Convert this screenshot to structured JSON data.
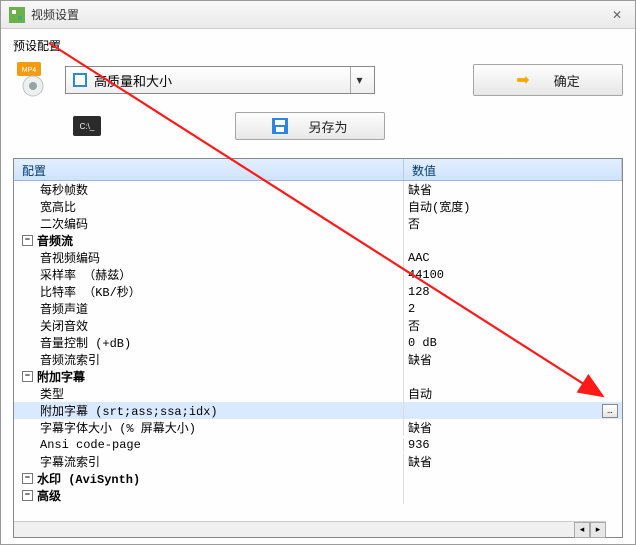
{
  "window": {
    "title": "视频设置"
  },
  "preset": {
    "label": "预设配置",
    "dropdown_value": "高质量和大小"
  },
  "buttons": {
    "ok": "确定",
    "save_as": "另存为"
  },
  "grid": {
    "header_name": "配置",
    "header_value": "数值",
    "rows": [
      {
        "type": "item",
        "name": "每秒帧数",
        "value": "缺省"
      },
      {
        "type": "item",
        "name": "宽高比",
        "value": "自动(宽度)"
      },
      {
        "type": "item",
        "name": "二次编码",
        "value": "否"
      },
      {
        "type": "group",
        "name": "音频流",
        "value": ""
      },
      {
        "type": "item",
        "name": "音视频编码",
        "value": "AAC"
      },
      {
        "type": "item",
        "name": "采样率 （赫兹）",
        "value": "44100"
      },
      {
        "type": "item",
        "name": "比特率 （KB/秒）",
        "value": "128"
      },
      {
        "type": "item",
        "name": "音频声道",
        "value": "2"
      },
      {
        "type": "item",
        "name": "关闭音效",
        "value": "否"
      },
      {
        "type": "item",
        "name": "音量控制 (+dB)",
        "value": "0 dB"
      },
      {
        "type": "item",
        "name": "音频流索引",
        "value": "缺省"
      },
      {
        "type": "group",
        "name": "附加字幕",
        "value": ""
      },
      {
        "type": "item",
        "name": "类型",
        "value": "自动"
      },
      {
        "type": "item",
        "name": "附加字幕 (srt;ass;ssa;idx)",
        "value": "",
        "selected": true
      },
      {
        "type": "item",
        "name": "字幕字体大小 (% 屏幕大小)",
        "value": "缺省"
      },
      {
        "type": "item",
        "name": "Ansi code-page",
        "value": "936"
      },
      {
        "type": "item",
        "name": "字幕流索引",
        "value": "缺省"
      },
      {
        "type": "group",
        "name": "水印 (AviSynth)",
        "value": ""
      },
      {
        "type": "group",
        "name": "高级",
        "value": ""
      }
    ]
  }
}
